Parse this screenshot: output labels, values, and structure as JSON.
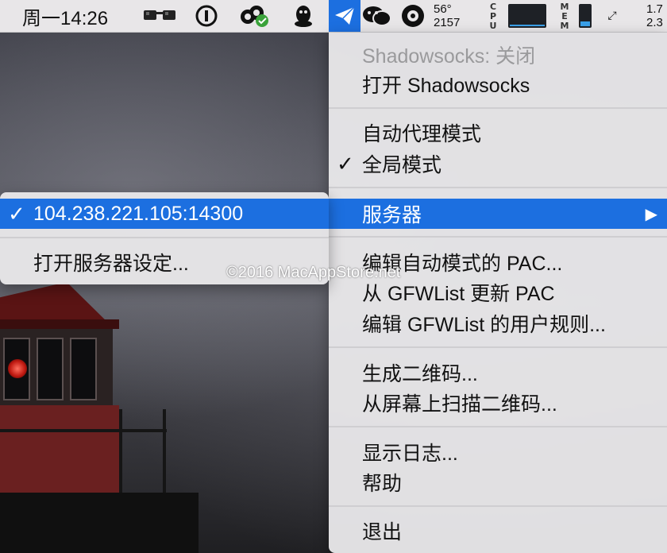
{
  "menubar": {
    "clock": "周一14:26",
    "weather_temp": "56°",
    "weather_value": "2157",
    "cpu_label": "CPU",
    "mem_label": "MEM",
    "net_up": "1.7",
    "net_down": "2.3",
    "icons": [
      "glasses-icon",
      "onepassword-icon",
      "cloud-sync-icon",
      "qq-penguin-icon",
      "shadowsocks-paperplane-icon",
      "wechat-icon",
      "gear-badge-icon"
    ]
  },
  "main_menu": {
    "status": "Shadowsocks: 关闭",
    "toggle": "打开 Shadowsocks",
    "auto_mode": "自动代理模式",
    "global_mode": "全局模式",
    "servers": "服务器",
    "edit_pac": "编辑自动模式的 PAC...",
    "update_pac": "从 GFWList 更新 PAC",
    "edit_rules": "编辑 GFWList 的用户规则...",
    "gen_qr": "生成二维码...",
    "scan_qr": "从屏幕上扫描二维码...",
    "show_log": "显示日志...",
    "help": "帮助",
    "quit": "退出",
    "check_mark": "✓",
    "submenu_arrow": "▶"
  },
  "server_menu": {
    "current_server": "104.238.221.105:14300",
    "open_settings": "打开服务器设定...",
    "check_mark": "✓"
  },
  "watermark": "©2016 MacAppStore.net",
  "colors": {
    "highlight": "#1c6fe0",
    "menu_bg": "#e8e7e9"
  }
}
